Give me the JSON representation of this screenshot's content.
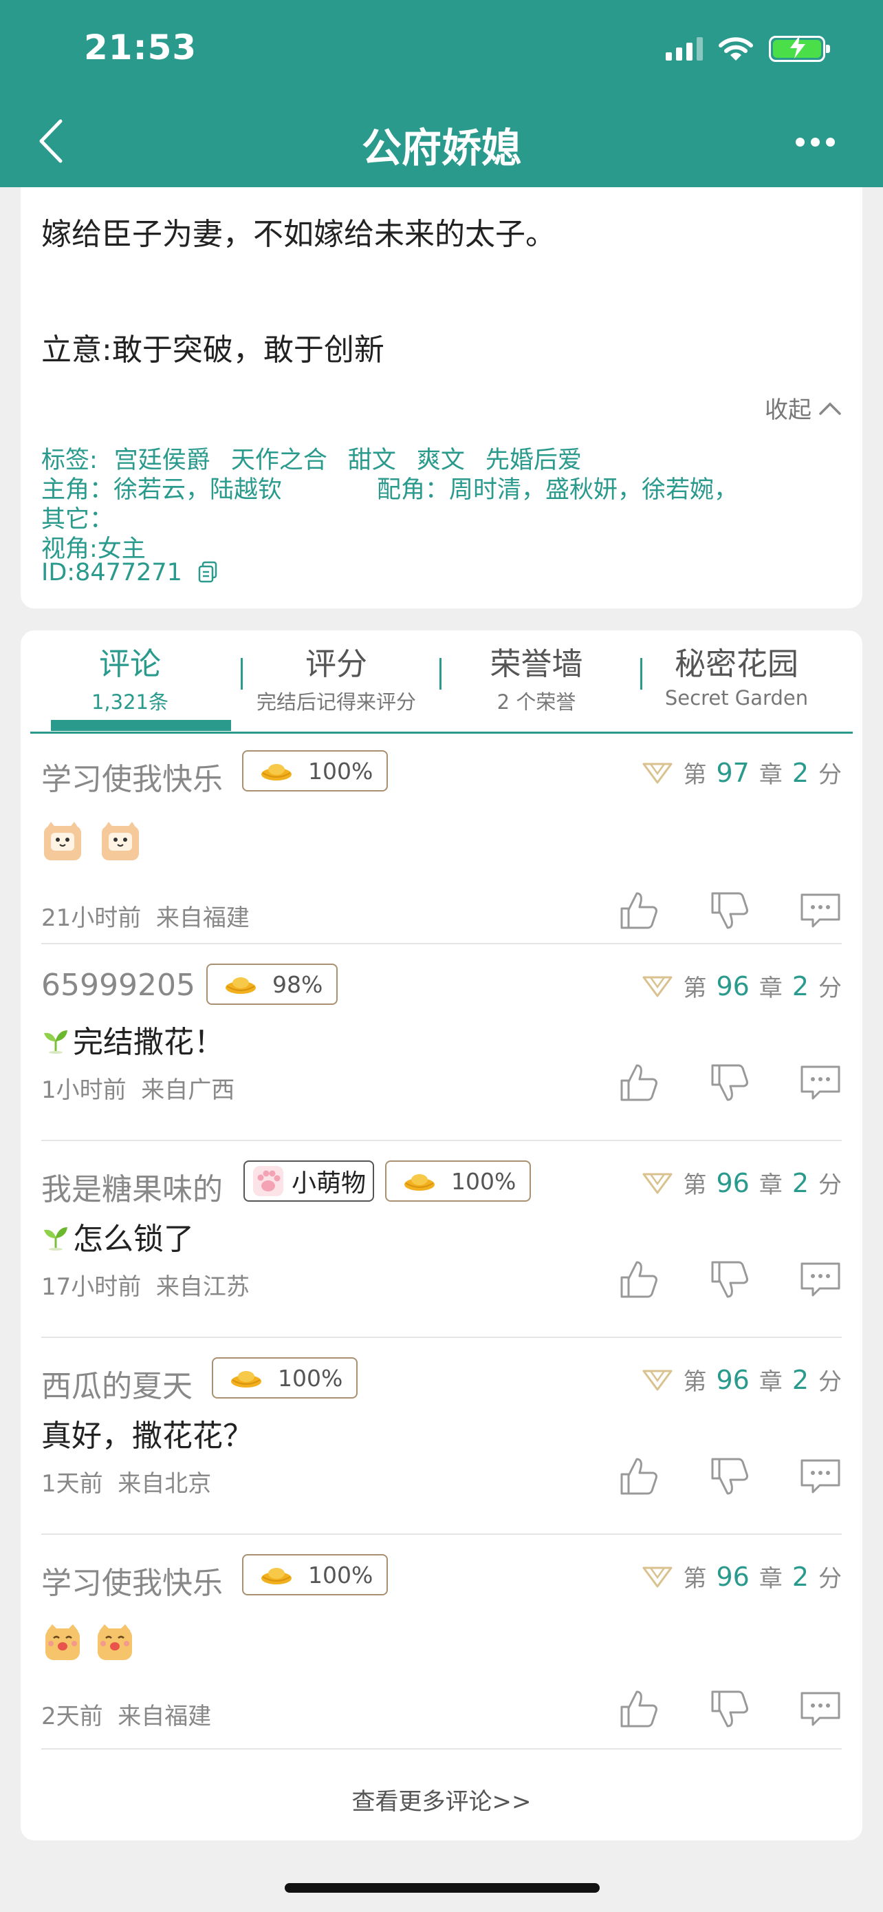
{
  "status_bar": {
    "time": "21:53"
  },
  "nav": {
    "title": "公府娇媳"
  },
  "synopsis": {
    "line1": "嫁给臣子为妻，不如嫁给未来的太子。",
    "line2": "立意:敢于突破，敢于创新",
    "collapse_label": "收起",
    "tags_label": "标签:",
    "tags": [
      "宫廷侯爵",
      "天作之合",
      "甜文",
      "爽文",
      "先婚后爱"
    ],
    "lead_label": "主角：",
    "lead": "徐若云，陆越钦",
    "support_label": "配角：",
    "support": "周时清，盛秋妍，徐若婉，",
    "other": "其它：",
    "pov": "视角:女主",
    "id": "ID:8477271"
  },
  "tabs": [
    {
      "title": "评论",
      "sub": "1,321条"
    },
    {
      "title": "评分",
      "sub": "完结后记得来评分"
    },
    {
      "title": "荣誉墙",
      "sub": "2 个荣誉"
    },
    {
      "title": "秘密花园",
      "sub": "Secret Garden"
    }
  ],
  "comments": [
    {
      "name": "学习使我快乐",
      "percent": "100%",
      "chapter_prefix": "第",
      "chapter": "97",
      "chapter_mid": "章",
      "score": "2",
      "score_suffix": "分",
      "time": "21小时前",
      "location": "来自福建"
    },
    {
      "name": "65999205",
      "percent": "98%",
      "chapter_prefix": "第",
      "chapter": "96",
      "chapter_mid": "章",
      "score": "2",
      "score_suffix": "分",
      "body": "完结撒花！",
      "time": "1小时前",
      "location": "来自广西"
    },
    {
      "name": "我是糖果味的",
      "pet_badge": "小萌物",
      "percent": "100%",
      "chapter_prefix": "第",
      "chapter": "96",
      "chapter_mid": "章",
      "score": "2",
      "score_suffix": "分",
      "body": "怎么锁了",
      "time": "17小时前",
      "location": "来自江苏"
    },
    {
      "name": "西瓜的夏天",
      "percent": "100%",
      "chapter_prefix": "第",
      "chapter": "96",
      "chapter_mid": "章",
      "score": "2",
      "score_suffix": "分",
      "body": "真好，撒花花？",
      "time": "1天前",
      "location": "来自北京"
    },
    {
      "name": "学习使我快乐",
      "percent": "100%",
      "chapter_prefix": "第",
      "chapter": "96",
      "chapter_mid": "章",
      "score": "2",
      "score_suffix": "分",
      "time": "2天前",
      "location": "来自福建"
    }
  ],
  "more_comments": "查看更多评论>>",
  "colors": {
    "accent": "#2a9a8d",
    "background": "#efefef"
  }
}
